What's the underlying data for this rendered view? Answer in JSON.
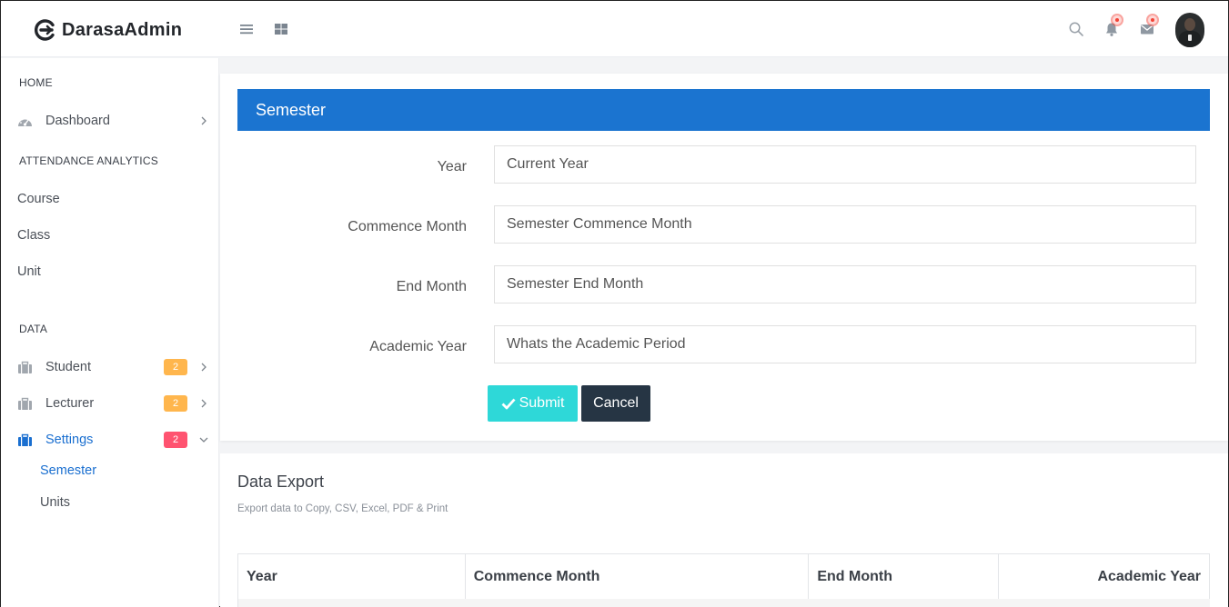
{
  "header": {
    "brand": "DarasaAdmin",
    "icons": [
      "menu-icon",
      "grid-icon",
      "search-icon",
      "bell-icon",
      "mail-icon"
    ]
  },
  "sidebar": {
    "headings": {
      "home": "HOME",
      "attendance": "ATTENDANCE ANALYTICS",
      "data": "DATA"
    },
    "dashboard": "Dashboard",
    "attendance_items": [
      "Course",
      "Class",
      "Unit"
    ],
    "data_items": [
      {
        "label": "Student",
        "badge": "2"
      },
      {
        "label": "Lecturer",
        "badge": "2"
      },
      {
        "label": "Settings",
        "badge": "2"
      }
    ],
    "settings_sub": [
      "Semester",
      "Units"
    ],
    "active_item": "Settings",
    "active_sub": "Semester"
  },
  "form": {
    "title": "Semester",
    "fields": [
      {
        "label": "Year",
        "placeholder": "Current Year"
      },
      {
        "label": "Commence Month",
        "placeholder": "Semester Commence Month"
      },
      {
        "label": "End Month",
        "placeholder": "Semester End Month"
      },
      {
        "label": "Academic Year",
        "placeholder": "Whats the Academic Period"
      }
    ],
    "submit_label": "Submit",
    "cancel_label": "Cancel"
  },
  "export": {
    "title": "Data Export",
    "subtitle": "Export data to Copy, CSV, Excel, PDF & Print",
    "columns": [
      "Year",
      "Commence Month",
      "End Month",
      "Academic Year"
    ]
  },
  "colors": {
    "primary": "#1b74d0",
    "submit": "#2ed8d8",
    "cancel": "#263544",
    "badge_orange": "#ffb64d",
    "badge_red": "#ff5370"
  }
}
